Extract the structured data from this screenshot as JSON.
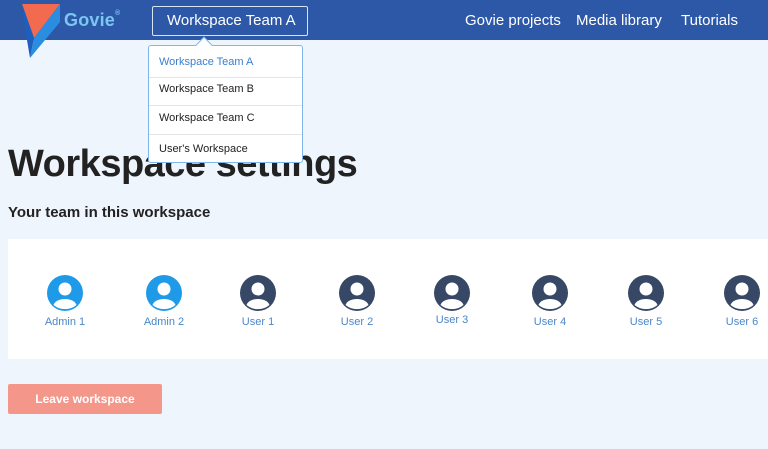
{
  "header": {
    "logo_text": "Govie",
    "logo_mark": "®",
    "workspace_selected": "Workspace Team A",
    "nav": [
      "Govie projects",
      "Media library",
      "Tutorials"
    ]
  },
  "dropdown": {
    "options": [
      "Workspace Team A",
      "Workspace Team B",
      "Workspace Team C",
      "User's Workspace"
    ]
  },
  "page": {
    "title": "Workspace settings",
    "subtitle": "Your team in this workspace"
  },
  "team": {
    "members": [
      {
        "name": "Admin 1",
        "role": "admin"
      },
      {
        "name": "Admin 2",
        "role": "admin"
      },
      {
        "name": "User 1",
        "role": "user"
      },
      {
        "name": "User 2",
        "role": "user"
      },
      {
        "name": "User 3",
        "role": "user"
      },
      {
        "name": "User 4",
        "role": "user"
      },
      {
        "name": "User 5",
        "role": "user"
      },
      {
        "name": "User 6",
        "role": "user"
      }
    ]
  },
  "actions": {
    "leave_label": "Leave workspace"
  },
  "colors": {
    "header_bg": "#2d57a7",
    "admin_avatar": "#1e9ae8",
    "user_avatar": "#374766",
    "danger_button": "#f4968a",
    "link": "#4a86c9"
  }
}
